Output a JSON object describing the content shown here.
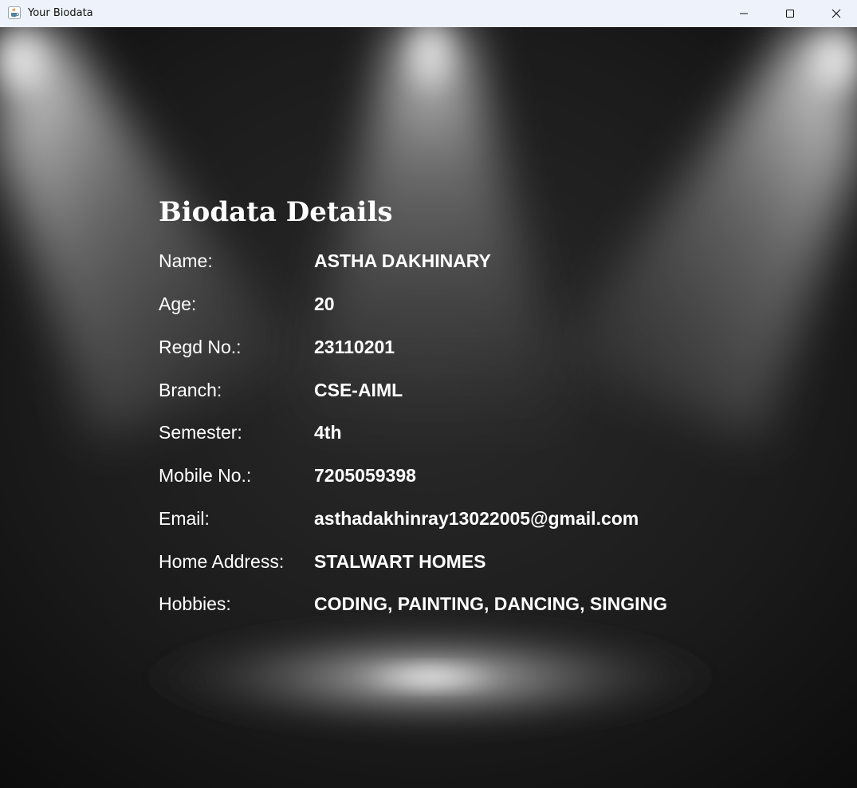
{
  "window": {
    "title": "Your Biodata"
  },
  "icons": {
    "app": "java-coffee-cup-icon",
    "minimize": "minimize-icon",
    "maximize": "maximize-icon",
    "close": "close-icon"
  },
  "biodata": {
    "heading": "Biodata Details",
    "fields": [
      {
        "label": "Name:",
        "value": "ASTHA DAKHINARY"
      },
      {
        "label": "Age:",
        "value": "20"
      },
      {
        "label": "Regd No.:",
        "value": "23110201"
      },
      {
        "label": "Branch:",
        "value": "CSE-AIML"
      },
      {
        "label": "Semester:",
        "value": "4th"
      },
      {
        "label": "Mobile No.:",
        "value": "7205059398"
      },
      {
        "label": "Email:",
        "value": "asthadakhinray13022005@gmail.com"
      },
      {
        "label": "Home Address:",
        "value": "STALWART HOMES"
      },
      {
        "label": "Hobbies:",
        "value": "CODING, PAINTING, DANCING, SINGING"
      }
    ]
  },
  "colors": {
    "titlebar": "#eef2fa",
    "background": "#161616",
    "text": "#ffffff"
  }
}
